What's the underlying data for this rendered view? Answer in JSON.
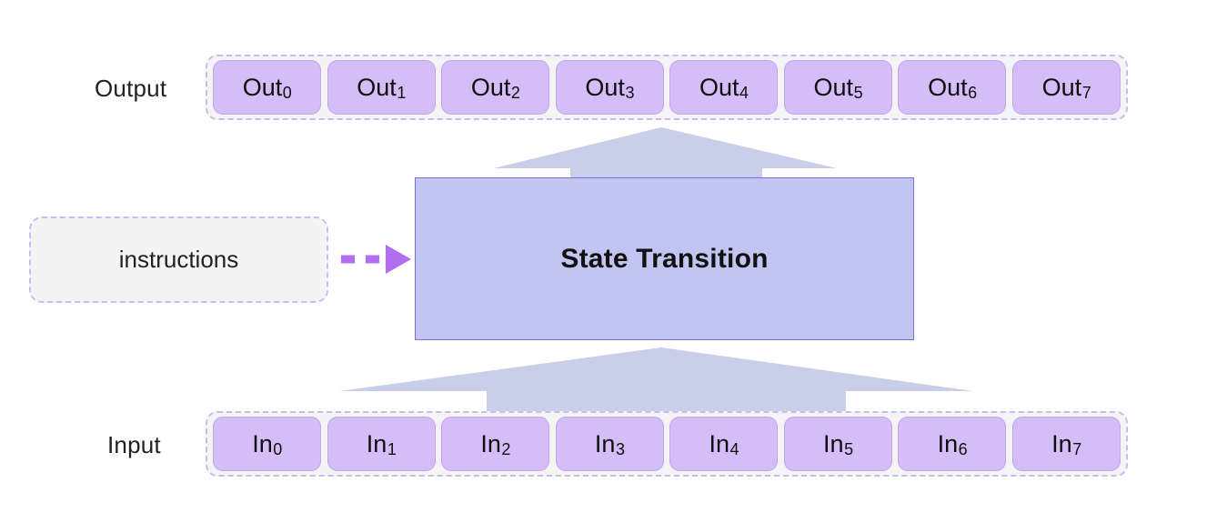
{
  "diagram": {
    "title": "State Transition block diagram",
    "colors": {
      "token_fill": "#d5bdf8",
      "token_border": "#c4a5f3",
      "strip_fill": "#f4f4f4",
      "strip_border": "#c9bdf0",
      "state_fill": "#c2c5f2",
      "state_border": "#7c6ce0",
      "funnel_fill": "#c9cfe9",
      "instruction_arrow": "#b06ef0",
      "text": "#202124",
      "background": "#ffffff"
    }
  },
  "output_row": {
    "label": "Output",
    "tokens": [
      {
        "base": "Out",
        "sub": "0"
      },
      {
        "base": "Out",
        "sub": "1"
      },
      {
        "base": "Out",
        "sub": "2"
      },
      {
        "base": "Out",
        "sub": "3"
      },
      {
        "base": "Out",
        "sub": "4"
      },
      {
        "base": "Out",
        "sub": "5"
      },
      {
        "base": "Out",
        "sub": "6"
      },
      {
        "base": "Out",
        "sub": "7"
      }
    ]
  },
  "input_row": {
    "label": "Input",
    "tokens": [
      {
        "base": "In",
        "sub": "0"
      },
      {
        "base": "In",
        "sub": "1"
      },
      {
        "base": "In",
        "sub": "2"
      },
      {
        "base": "In",
        "sub": "3"
      },
      {
        "base": "In",
        "sub": "4"
      },
      {
        "base": "In",
        "sub": "5"
      },
      {
        "base": "In",
        "sub": "6"
      },
      {
        "base": "In",
        "sub": "7"
      }
    ]
  },
  "state_transition": {
    "title": "State Transition"
  },
  "instructions": {
    "label": "instructions"
  },
  "connectors": {
    "instructions_to_state": "dashed-arrow-right",
    "input_to_state": "funnel-arrow-up",
    "state_to_output": "funnel-arrow-up"
  }
}
